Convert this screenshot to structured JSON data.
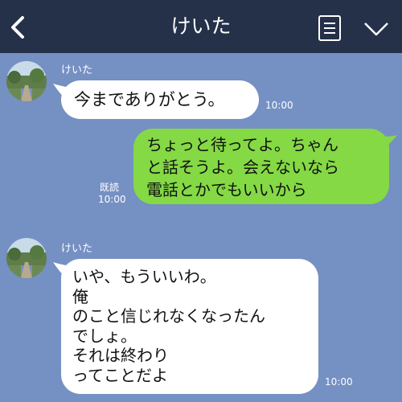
{
  "header": {
    "title": "けいた",
    "back_icon": "chevron-left-icon",
    "menu_icon": "note-list-icon",
    "expand_icon": "chevron-down-icon"
  },
  "colors": {
    "background": "#7590c3",
    "header": "#253049",
    "incoming": "#ffffff",
    "outgoing": "#84d944"
  },
  "messages": [
    {
      "sender": "けいた",
      "text": "今までありがとう。",
      "time": "10:00"
    },
    {
      "text": "ちょっと待ってよ。ちゃん\nと話そうよ。会えないなら\n電話とかでもいいから",
      "read": "既読",
      "time": "10:00"
    },
    {
      "sender": "けいた",
      "text": "いや、もういいわ。\n俺\nのこと信じれなくなったん\nでしょ。\nそれは終わり\nってことだよ",
      "time": "10:00"
    }
  ]
}
